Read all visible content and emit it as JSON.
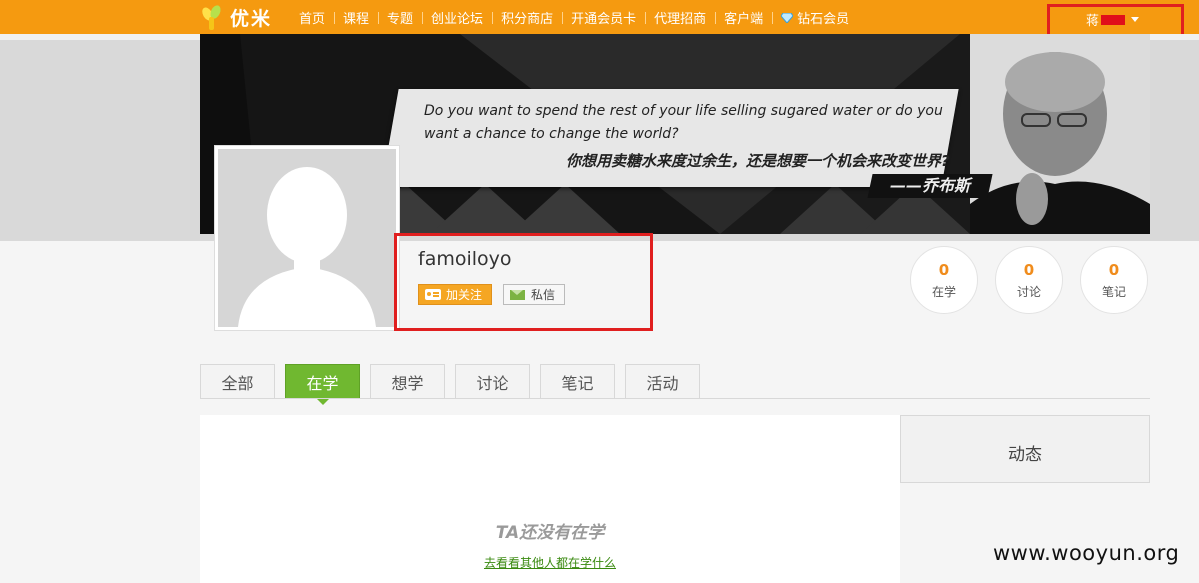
{
  "header": {
    "logo_text": "优米",
    "nav": [
      "首页",
      "课程",
      "专题",
      "创业论坛",
      "积分商店",
      "开通会员卡",
      "代理招商",
      "客户端"
    ],
    "vip_label": "钻石会员",
    "username": "蒋",
    "logo_icon": "youmi-logo-icon",
    "diamond_icon": "diamond-icon"
  },
  "banner": {
    "quote_en": "Do you want to spend the rest of your life selling sugared water or do you want a chance to change the world?",
    "quote_cn": "你想用卖糖水来度过余生，还是想要一个机会来改变世界?",
    "quote_author": "——乔布斯"
  },
  "profile": {
    "name": "famoiloyo",
    "follow_label": "加关注",
    "message_label": "私信"
  },
  "stats": [
    {
      "value": "0",
      "label": "在学"
    },
    {
      "value": "0",
      "label": "讨论"
    },
    {
      "value": "0",
      "label": "笔记"
    }
  ],
  "tabs": [
    "全部",
    "在学",
    "想学",
    "讨论",
    "笔记",
    "活动"
  ],
  "active_tab": "在学",
  "main": {
    "empty_title": "TA还没有在学",
    "empty_link": "去看看其他人都在学什么"
  },
  "side": {
    "title": "动态"
  },
  "watermark": "www.wooyun.org",
  "colors": {
    "topbar": "#f59a10",
    "accent_green": "#70b830",
    "stat_number": "#f08c1c",
    "highlight_red": "#e01f1f"
  }
}
